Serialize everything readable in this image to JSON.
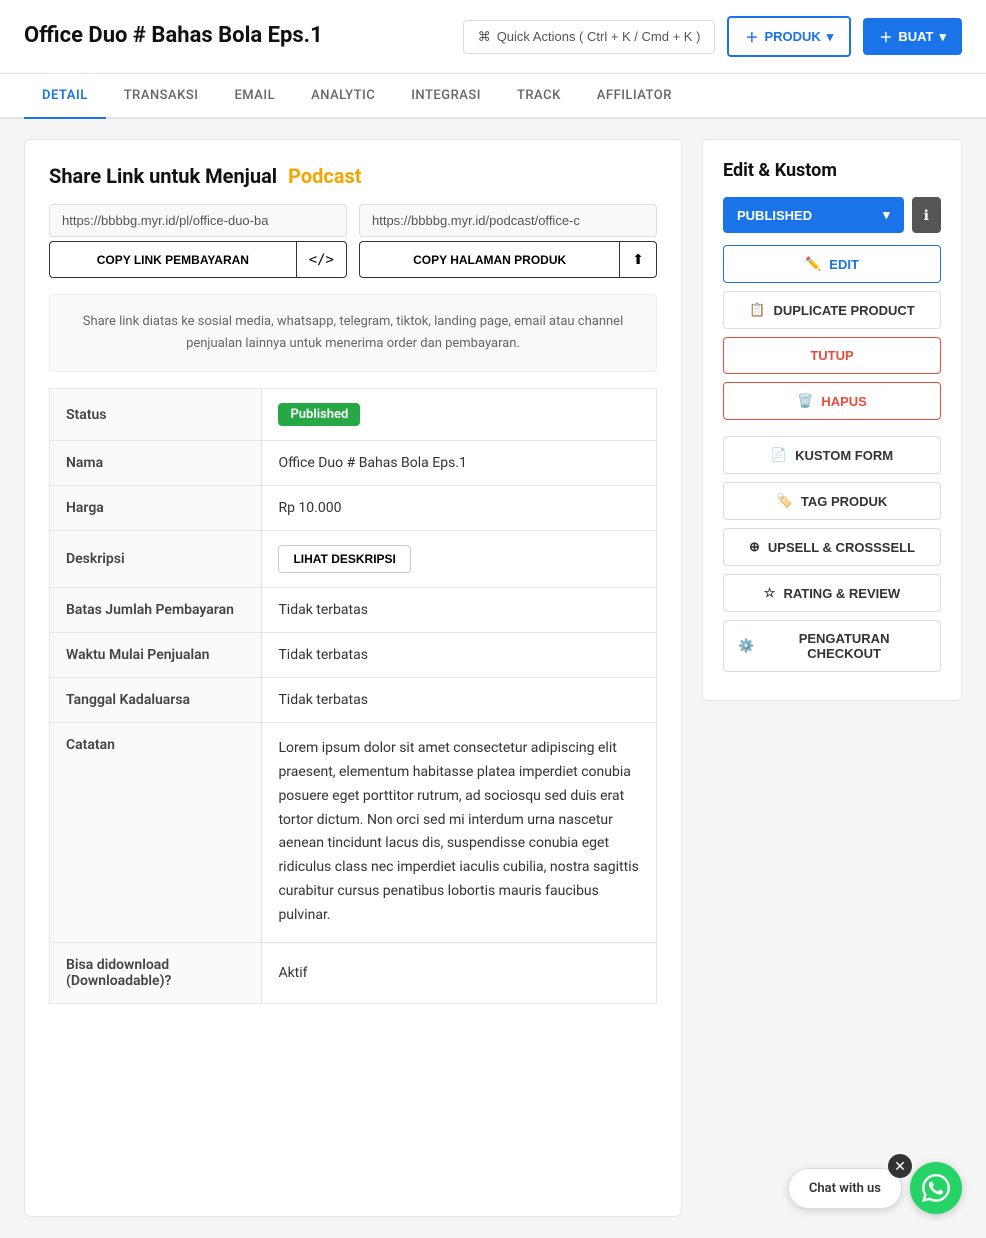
{
  "header": {
    "title": "Office Duo # Bahas Bola Eps.1",
    "quick_actions_label": "Quick Actions ( Ctrl + K / Cmd + K )",
    "produk_label": "PRODUK",
    "buat_label": "BUAT"
  },
  "tabs": [
    {
      "label": "DETAIL",
      "active": true
    },
    {
      "label": "TRANSAKSI",
      "active": false
    },
    {
      "label": "EMAIL",
      "active": false
    },
    {
      "label": "ANALYTIC",
      "active": false
    },
    {
      "label": "INTEGRASI",
      "active": false
    },
    {
      "label": "TRACK",
      "active": false
    },
    {
      "label": "AFFILIATOR",
      "active": false
    }
  ],
  "main": {
    "share_title_start": "Share Link untuk Menjual",
    "share_title_highlight": "Podcast",
    "link_payment": "https://bbbbg.myr.id/pl/office-duo-ba",
    "link_product": "https://bbbbg.myr.id/podcast/office-c",
    "copy_payment_label": "COPY LINK PEMBAYARAN",
    "copy_product_label": "COPY HALAMAN PRODUK",
    "share_note": "Share link diatas ke sosial media, whatsapp, telegram, tiktok, landing page, email atau channel penjualan lainnya untuk menerima order dan pembayaran.",
    "table": {
      "rows": [
        {
          "label": "Status",
          "value": "Published",
          "type": "badge"
        },
        {
          "label": "Nama",
          "value": "Office Duo # Bahas Bola Eps.1",
          "type": "text"
        },
        {
          "label": "Harga",
          "value": "Rp 10.000",
          "type": "text"
        },
        {
          "label": "Deskripsi",
          "value": "LIHAT DESKRIPSI",
          "type": "button"
        },
        {
          "label": "Batas Jumlah Pembayaran",
          "value": "Tidak terbatas",
          "type": "text"
        },
        {
          "label": "Waktu Mulai Penjualan",
          "value": "Tidak terbatas",
          "type": "text"
        },
        {
          "label": "Tanggal Kadaluarsa",
          "value": "Tidak terbatas",
          "type": "text"
        },
        {
          "label": "Catatan",
          "value": "Lorem ipsum dolor sit amet consectetur adipiscing elit praesent, elementum habitasse platea imperdiet conubia posuere eget porttitor rutrum, ad sociosqu sed duis erat tortor dictum. Non orci sed mi interdum urna nascetur aenean tincidunt lacus dis, suspendisse conubia eget ridiculus class nec imperdiet iaculis cubilia, nostra sagittis curabitur cursus penatibus lobortis mauris faucibus pulvinar.",
          "type": "text"
        },
        {
          "label": "Bisa didownload (Downloadable)?",
          "value": "Aktif",
          "type": "text"
        }
      ]
    }
  },
  "side": {
    "title": "Edit & Kustom",
    "published_label": "PUBLISHED",
    "buttons": [
      {
        "label": "EDIT",
        "icon": "✏️",
        "style": "edit"
      },
      {
        "label": "DUPLICATE PRODUCT",
        "icon": "📋",
        "style": "normal"
      },
      {
        "label": "TUTUP",
        "icon": "",
        "style": "tutup"
      },
      {
        "label": "HAPUS",
        "icon": "🗑️",
        "style": "hapus"
      },
      {
        "label": "KUSTOM FORM",
        "icon": "📄",
        "style": "normal"
      },
      {
        "label": "TAG PRODUK",
        "icon": "🏷️",
        "style": "normal"
      },
      {
        "label": "UPSELL & CROSSSELL",
        "icon": "⊕",
        "style": "normal"
      },
      {
        "label": "RATING & REVIEW",
        "icon": "☆",
        "style": "normal"
      },
      {
        "label": "PENGATURAN CHECKOUT",
        "icon": "⚙️",
        "style": "normal"
      }
    ]
  },
  "chat": {
    "label": "Chat with us"
  }
}
